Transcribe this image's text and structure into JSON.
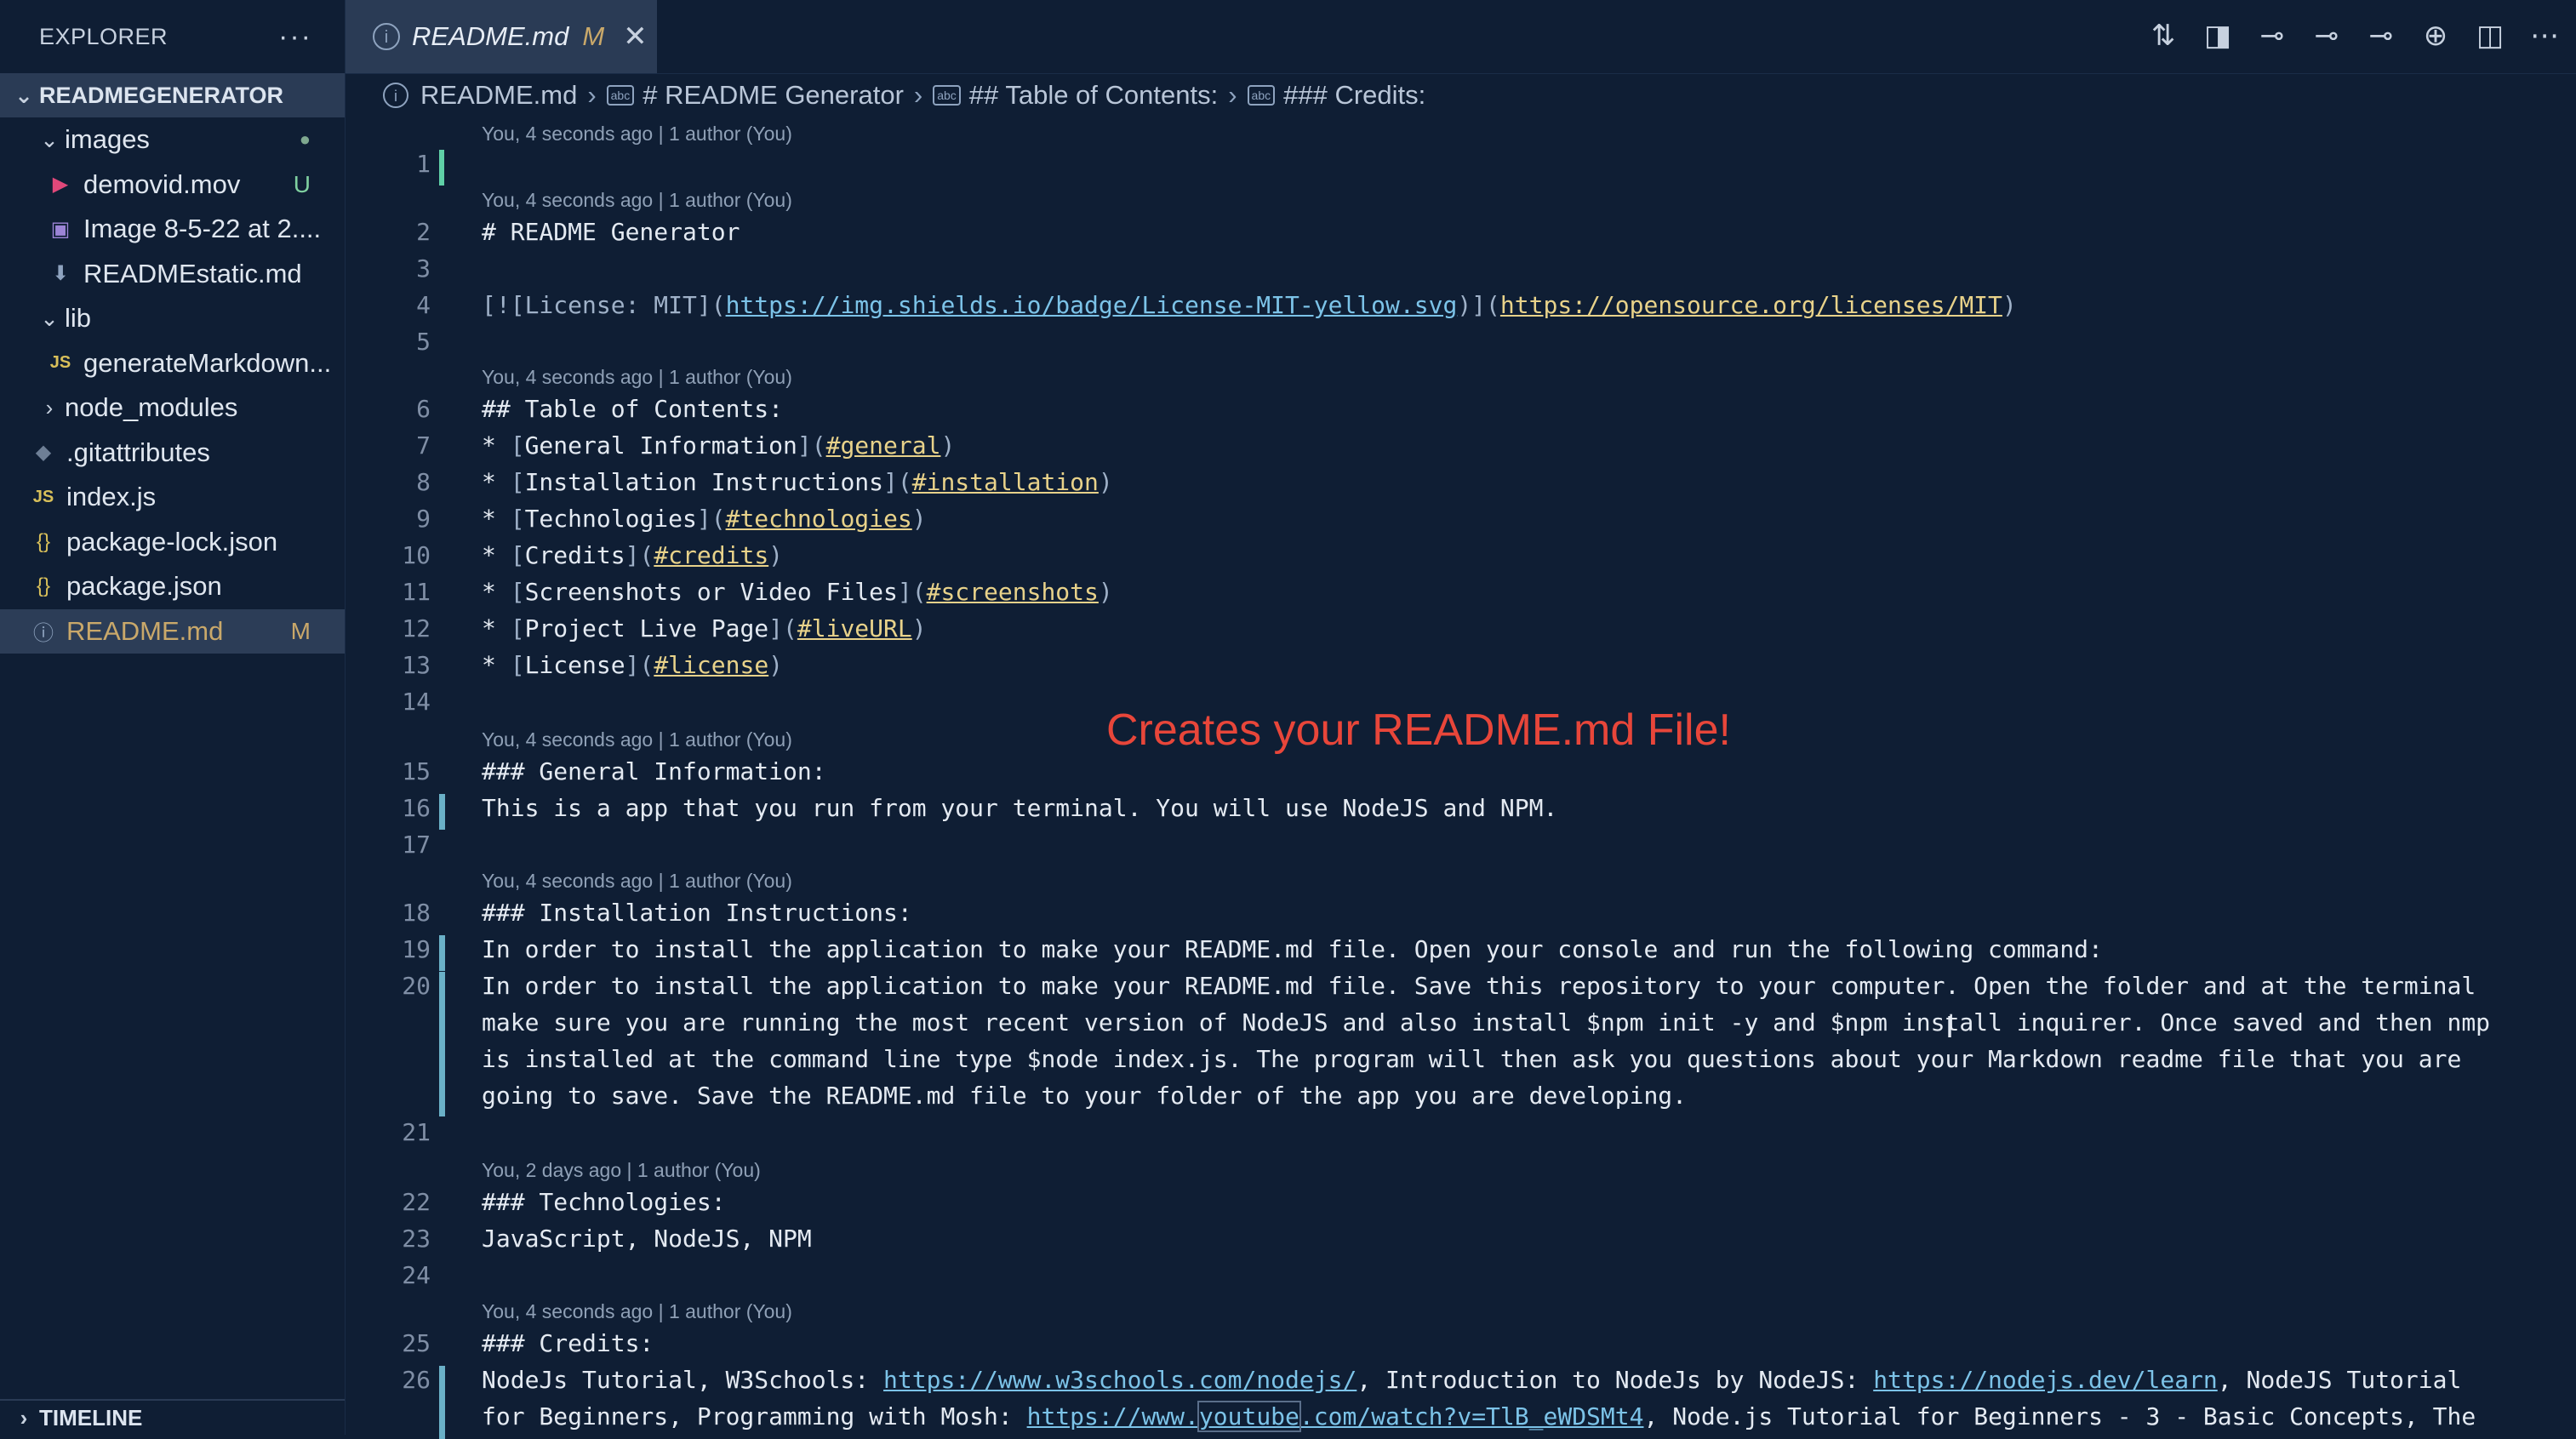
{
  "sidebar": {
    "explorer_title": "EXPLORER",
    "more_actions": "···",
    "project_name": "READMEGENERATOR",
    "items": [
      {
        "label": "images",
        "kind": "folder",
        "badge": "●"
      },
      {
        "label": "demovid.mov",
        "kind": "file",
        "badge": "U"
      },
      {
        "label": "Image 8-5-22 at 2....",
        "kind": "file",
        "badge": ""
      },
      {
        "label": "READMEstatic.md",
        "kind": "file",
        "badge": ""
      },
      {
        "label": "lib",
        "kind": "folder",
        "badge": ""
      },
      {
        "label": "generateMarkdown...",
        "kind": "file",
        "badge": ""
      },
      {
        "label": "node_modules",
        "kind": "folder",
        "badge": ""
      },
      {
        "label": ".gitattributes",
        "kind": "file",
        "badge": ""
      },
      {
        "label": "index.js",
        "kind": "file",
        "badge": ""
      },
      {
        "label": "package-lock.json",
        "kind": "file",
        "badge": ""
      },
      {
        "label": "package.json",
        "kind": "file",
        "badge": ""
      },
      {
        "label": "README.md",
        "kind": "file",
        "badge": "M"
      }
    ],
    "timeline_label": "TIMELINE"
  },
  "tab": {
    "label": "README.md",
    "status": "M",
    "close": "✕"
  },
  "breadcrumb": [
    "README.md",
    "# README Generator",
    "## Table of Contents:",
    "### Credits:"
  ],
  "editor": {
    "blame_recent": "You, 4 seconds ago | 1 author (You)",
    "blame_old": "You, 2 days ago | 1 author (You)",
    "lines": {
      "l2": "# README Generator",
      "l4_a": "[![License: MIT](",
      "l4_url1": "https://img.shields.io/badge/License-MIT-yellow.svg",
      "l4_b": ")](",
      "l4_url2": "https://opensource.org/licenses/MIT",
      "l4_c": ")",
      "l6": "## Table of Contents:",
      "toc": [
        {
          "text": "General Information",
          "anchor": "#general"
        },
        {
          "text": "Installation Instructions",
          "anchor": "#installation"
        },
        {
          "text": "Technologies",
          "anchor": "#technologies"
        },
        {
          "text": "Credits",
          "anchor": "#credits"
        },
        {
          "text": "Screenshots or Video Files",
          "anchor": "#screenshots"
        },
        {
          "text": "Project Live Page",
          "anchor": "#liveURL"
        },
        {
          "text": "License",
          "anchor": "#license"
        }
      ],
      "l15": "### General Information:",
      "l16": "This is a app that you run from your terminal. You will use NodeJS and NPM.",
      "l18": "### Installation Instructions:",
      "l19": "In order to install the application to make your README.md file.  Open your console and run the following command:",
      "l20_1": "In order to install the application to make your README.md file. Save this repository to your computer. Open the folder and at the terminal",
      "l20_2": "make sure you are running the most recent version of NodeJS and also install $npm init -y and $npm install inquirer. Once saved and then nmp",
      "l20_3": "is installed at the command line type $node index.js. The program will then ask you questions about your Markdown readme file that you are",
      "l20_4": "going to save. Save the README.md file to your folder of the app you are developing.",
      "l22": "### Technologies:",
      "l23": "JavaScript, NodeJS, NPM",
      "l25": "### Credits:",
      "l26_a": "NodeJs Tutorial, W3Schools: ",
      "l26_url1": "https://www.w3schools.com/nodejs/",
      "l26_b": ", Introduction to NodeJs by NodeJS: ",
      "l26_url2": "https://nodejs.dev/learn",
      "l26_c": ", NodeJS Tutorial",
      "l26_d": "for Beginners, Programming with Mosh: ",
      "l26_url3a": "https://www.",
      "l26_url3b": "youtube",
      "l26_url3c": ".com/watch?v=TlB_eWDSMt4",
      "l26_e": ", Node.js Tutorial for Beginners - 3 - Basic Concepts, The"
    }
  },
  "overlay_text": "Creates your README.md File!",
  "colors": {
    "accent_red": "#e8463a",
    "link_yellow": "#e8d28a",
    "background": "#0f1e34"
  }
}
